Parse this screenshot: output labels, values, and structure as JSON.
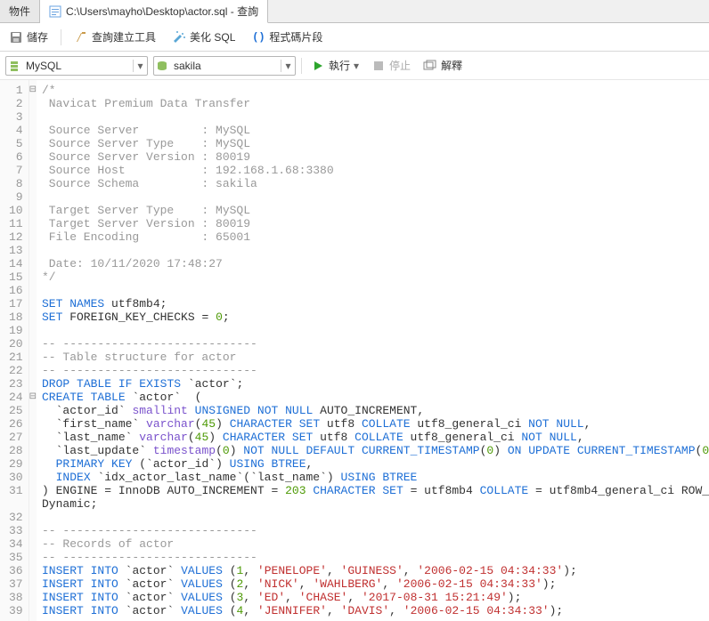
{
  "tabs": {
    "objects": "物件",
    "file": "C:\\Users\\mayho\\Desktop\\actor.sql - 查詢"
  },
  "toolbar": {
    "save": "儲存",
    "query_builder": "查詢建立工具",
    "beautify": "美化 SQL",
    "snippet": "程式碼片段"
  },
  "row2": {
    "conn": "MySQL",
    "db": "sakila",
    "run": "執行",
    "stop": "停止",
    "explain": "解釋"
  },
  "code": {
    "l1": "/*",
    "l2": " Navicat Premium Data Transfer",
    "l3": "",
    "l4": " Source Server         : MySQL",
    "l5": " Source Server Type    : MySQL",
    "l6": " Source Server Version : 80019",
    "l7": " Source Host           : 192.168.1.68:3380",
    "l8": " Source Schema         : sakila",
    "l9": "",
    "l10": " Target Server Type    : MySQL",
    "l11": " Target Server Version : 80019",
    "l12": " File Encoding         : 65001",
    "l13": "",
    "l14": " Date: 10/11/2020 17:48:27",
    "l15": "*/",
    "l18_num": "0",
    "l21": "-- Table structure for actor",
    "l27a": "`last_name`",
    "l27b": "45",
    "l31_num": "203",
    "l34": "-- Records of actor",
    "l36": {
      "n": "1",
      "a": "'PENELOPE'",
      "b": "'GUINESS'",
      "c": "'2006-02-15 04:34:33'"
    },
    "l37": {
      "n": "2",
      "a": "'NICK'",
      "b": "'WAHLBERG'",
      "c": "'2006-02-15 04:34:33'"
    },
    "l38": {
      "n": "3",
      "a": "'ED'",
      "b": "'CHASE'",
      "c": "'2017-08-31 15:21:49'"
    },
    "l39": {
      "n": "4",
      "a": "'JENNIFER'",
      "b": "'DAVIS'",
      "c": "'2006-02-15 04:34:33'"
    }
  }
}
